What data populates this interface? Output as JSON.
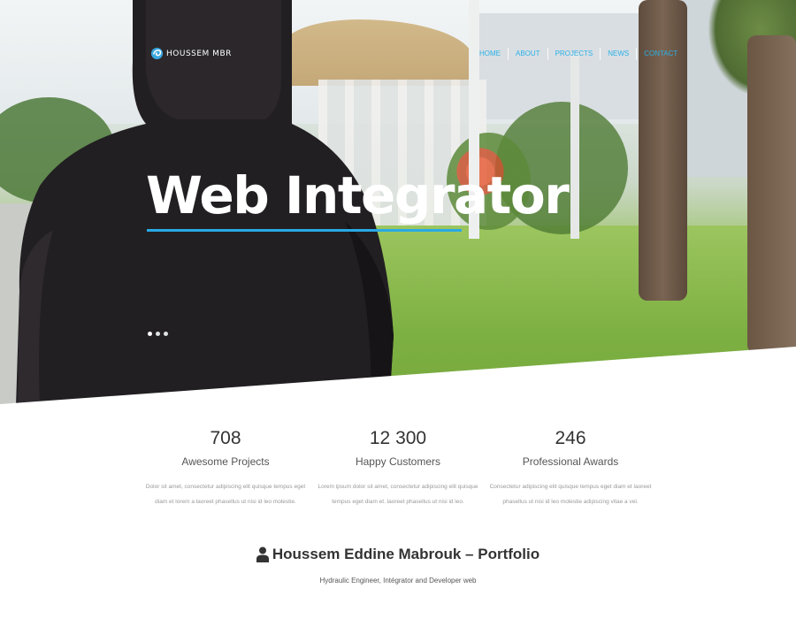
{
  "header": {
    "brand": "HOUSSEM MBR",
    "nav": [
      "HOME",
      "ABOUT",
      "PROJECTS",
      "NEWS",
      "CONTACT"
    ]
  },
  "hero": {
    "title": "Web Integrator",
    "slider_dots": 3,
    "accent_color": "#29a9e5"
  },
  "stats": [
    {
      "value": "708",
      "label": "Awesome Projects",
      "text": "Dolor sit amet, consectetur adipiscing elit quisque tempus eget diam et lorem a laoreet phasellus ut nisi id leo molestie."
    },
    {
      "value": "12 300",
      "label": "Happy Customers",
      "text": "Lorem ipsum dolor sit amet, consectetur adipiscing elit quisque tempus eget diam et. laoreet phasellus ut nisi id leo."
    },
    {
      "value": "246",
      "label": "Professional Awards",
      "text": "Consectetur adipiscing elit quisque tempus eget diam et laoreet phasellus ut nisi id leo molestie adipiscing vitae a vel."
    }
  ],
  "about": {
    "title": "Houssem Eddine Mabrouk – Portfolio",
    "icon": "user-icon",
    "subtitle": "Hydraulic Engineer, Intégrator and Developer web"
  }
}
